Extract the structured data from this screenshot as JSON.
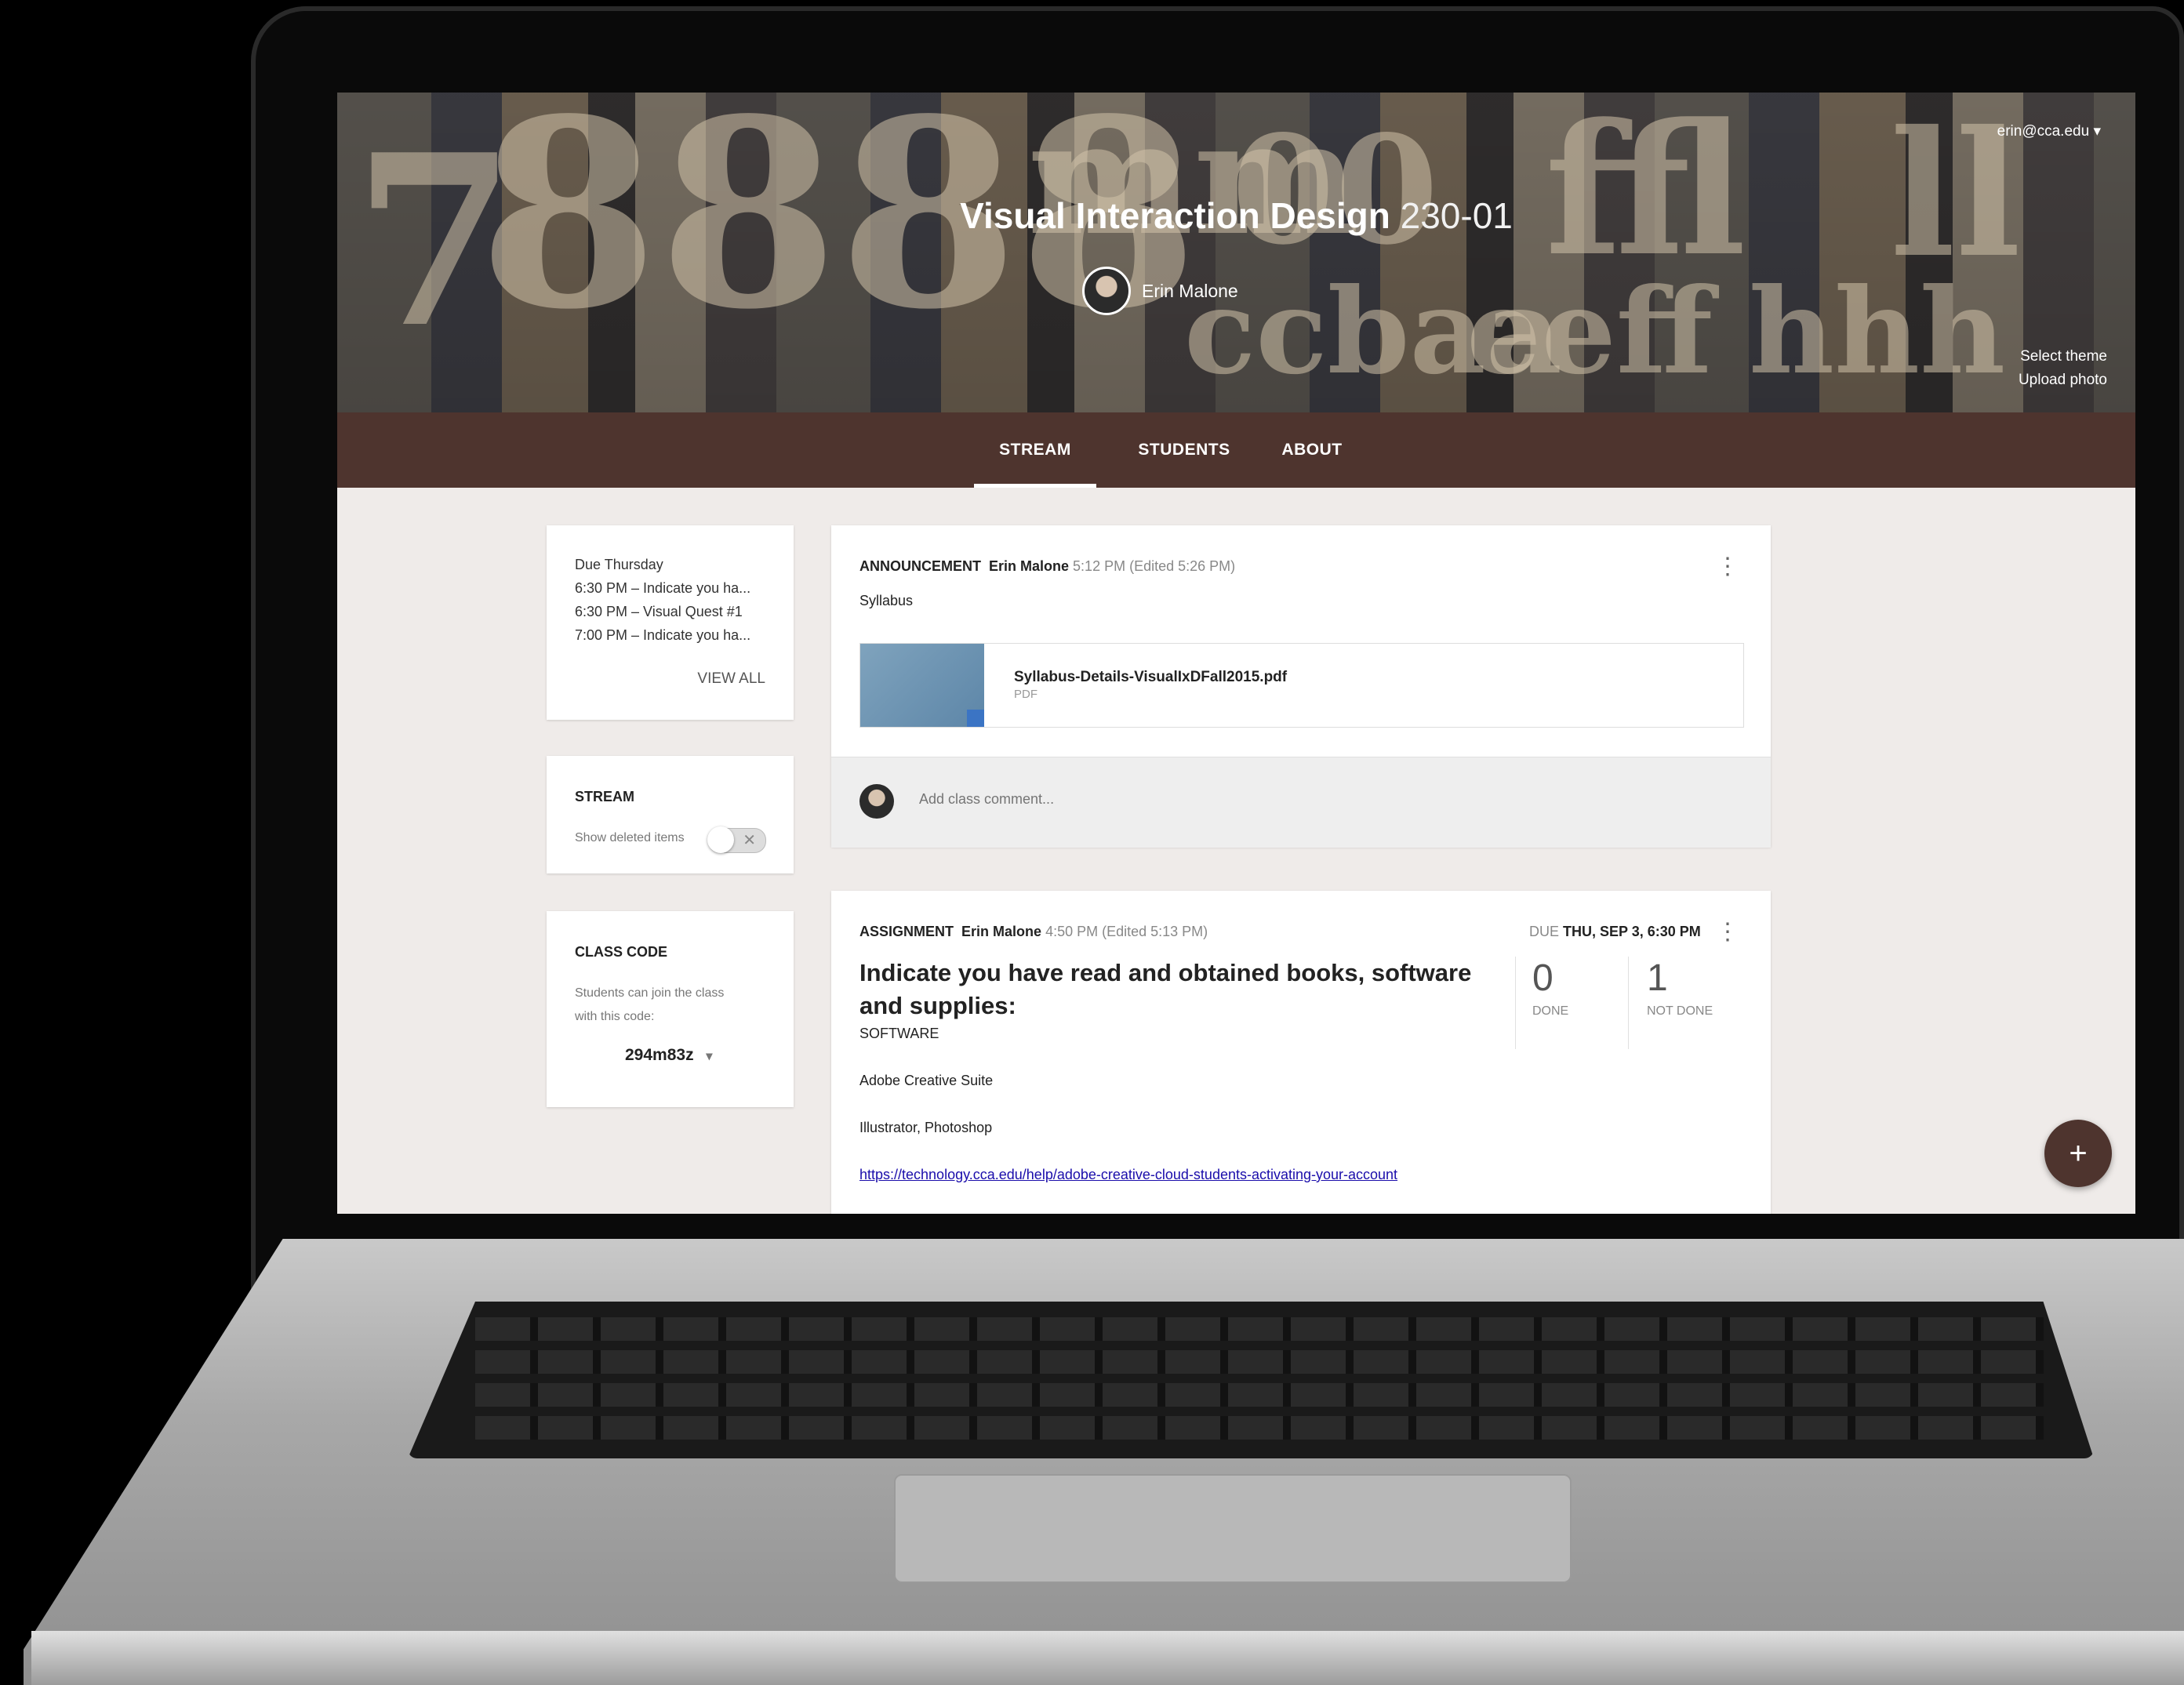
{
  "header": {
    "course_title_bold": "Visual Interaction Design",
    "course_number": "230-01",
    "teacher_name": "Erin Malone",
    "account_email": "erin@cca.edu",
    "select_theme": "Select theme",
    "upload_photo": "Upload photo"
  },
  "tabs": [
    {
      "label": "STREAM",
      "active": true
    },
    {
      "label": "STUDENTS",
      "active": false
    },
    {
      "label": "ABOUT",
      "active": false
    }
  ],
  "upcoming": {
    "heading": "Due Thursday",
    "items": [
      "6:30 PM – Indicate you ha...",
      "6:30 PM – Visual Quest #1",
      "7:00 PM – Indicate you ha..."
    ],
    "view_all": "VIEW ALL"
  },
  "stream_settings": {
    "title": "STREAM",
    "toggle_label": "Show deleted items",
    "toggle_on": false
  },
  "class_code": {
    "title": "CLASS CODE",
    "description_line1": "Students can join the class",
    "description_line2": "with this code:",
    "code": "294m83z"
  },
  "announcement": {
    "type": "ANNOUNCEMENT",
    "author": "Erin Malone",
    "time": "5:12 PM (Edited 5:26 PM)",
    "text": "Syllabus",
    "attachment_name": "Syllabus-Details-VisualIxDFall2015.pdf",
    "attachment_type": "PDF",
    "comment_placeholder": "Add class comment..."
  },
  "assignment": {
    "type": "ASSIGNMENT",
    "author": "Erin Malone",
    "time": "4:50 PM (Edited 5:13 PM)",
    "due_prefix": "DUE",
    "due_date": "THU, SEP 3, 6:30 PM",
    "title": "Indicate you have read and obtained books, software and supplies:",
    "section": "SOFTWARE",
    "line1": "Adobe Creative Suite",
    "line2": "Illustrator, Photoshop",
    "link": "https://technology.cca.edu/help/adobe-creative-cloud-students-activating-your-account",
    "done_count": "0",
    "done_label": "DONE",
    "not_done_count": "1",
    "not_done_label": "NOT DONE"
  },
  "fab_symbol": "+",
  "colors": {
    "tabbar": "#4e342e",
    "background": "#efebe9",
    "fab": "#4e342e"
  }
}
